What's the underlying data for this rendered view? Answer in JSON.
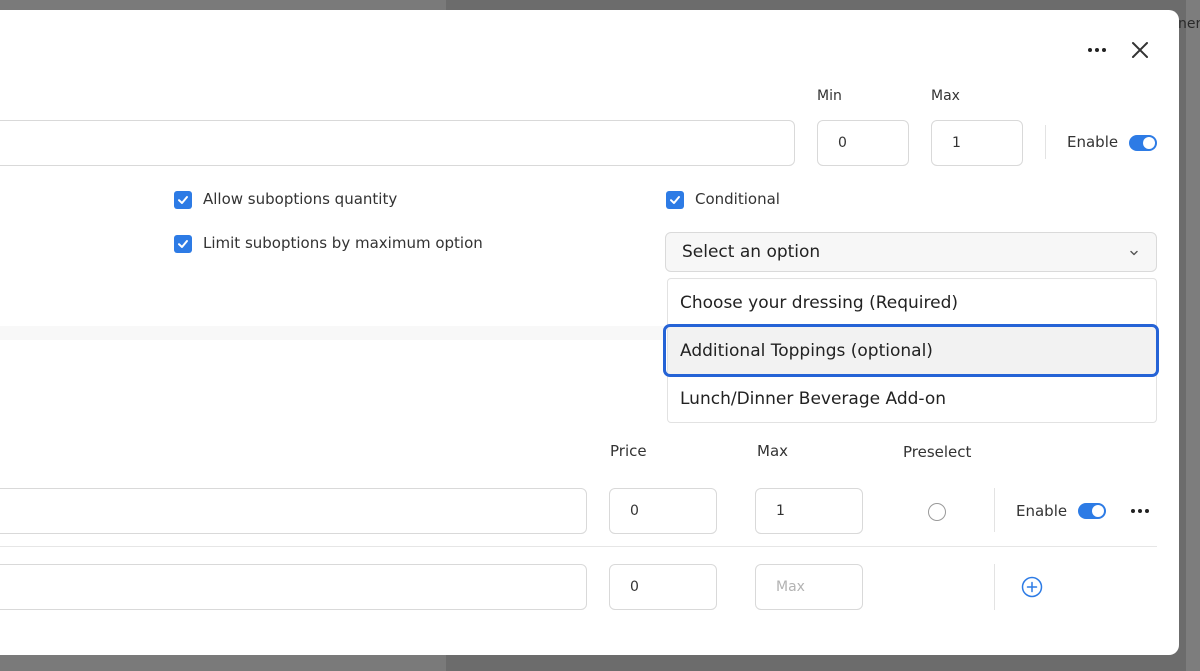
{
  "backdrop": {
    "peek_text": "ner"
  },
  "header": {
    "more_icon": "ellipsis-icon",
    "close_icon": "close-icon"
  },
  "option_group": {
    "min_label": "Min",
    "max_label": "Max",
    "min_value": "0",
    "max_value": "1",
    "enable_label": "Enable",
    "enabled": true
  },
  "settings": {
    "allow_quantity_label": "Allow suboptions quantity",
    "allow_quantity_checked": true,
    "limit_by_max_label": "Limit suboptions by maximum option",
    "limit_by_max_checked": true,
    "conditional_label": "Conditional",
    "conditional_checked": true
  },
  "condition_select": {
    "placeholder": "Select an option",
    "options": [
      "Choose your dressing (Required)",
      "Additional Toppings (optional)",
      "Lunch/Dinner Beverage Add-on"
    ],
    "highlighted_index": 1
  },
  "suboptions": {
    "headers": {
      "price": "Price",
      "max": "Max",
      "preselect": "Preselect"
    },
    "rows": [
      {
        "price": "0",
        "max": "1",
        "enable_label": "Enable",
        "enabled": true
      },
      {
        "price": "0",
        "max": "",
        "max_placeholder": "Max"
      }
    ]
  },
  "colors": {
    "accent": "#2d7be5",
    "focus_ring": "#2563d6"
  }
}
